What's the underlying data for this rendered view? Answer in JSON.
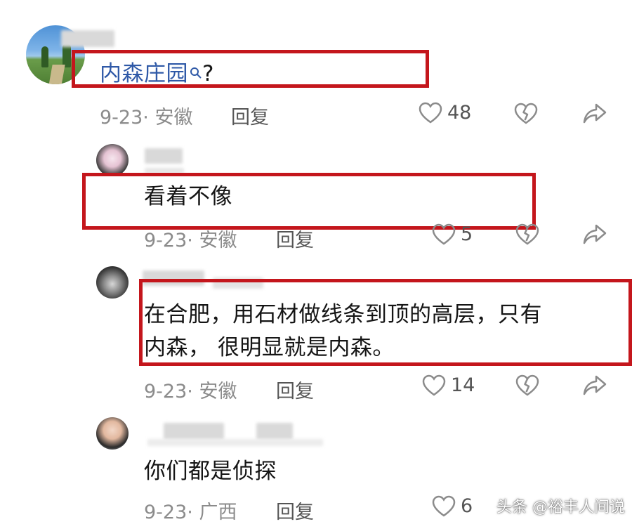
{
  "watermark": "头条 @裕丰人间说",
  "comments": [
    {
      "text": "内森庄园",
      "suffix": "?",
      "date_loc": "9-23· 安徽",
      "reply": "回复",
      "likes": "48"
    },
    {
      "text": "看着不像",
      "date_loc": "9-23· 安徽",
      "reply": "回复",
      "likes": "5"
    },
    {
      "text_line1": "在合肥，用石材做线条到顶的高层，只有",
      "text_line2": "内森， 很明显就是内森。",
      "date_loc": "9-23· 安徽",
      "reply": "回复",
      "likes": "14"
    },
    {
      "text": "你们都是侦探",
      "date_loc": "9-23· 广西",
      "reply": "回复",
      "likes": "6"
    }
  ],
  "colors": {
    "highlight": "#c4161c",
    "link": "#2f59a7",
    "meta": "#8b8b8b"
  }
}
